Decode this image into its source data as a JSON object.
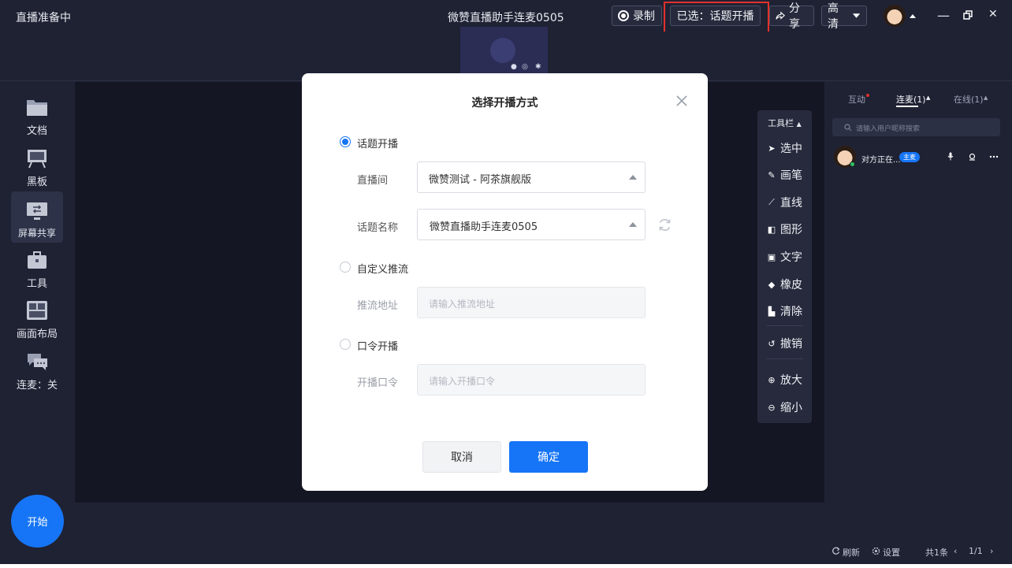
{
  "titlebar": {
    "status": "直播准备中",
    "title": "微赞直播助手连麦0505",
    "record_label": "录制",
    "selected_label": "已选：话题开播",
    "share_label": "分享",
    "quality_label": "高清",
    "minimize_glyph": "—",
    "close_glyph": "✕"
  },
  "sidebar": {
    "items": [
      {
        "label": "文档"
      },
      {
        "label": "黑板"
      },
      {
        "label": "屏幕共享"
      },
      {
        "label": "工具"
      },
      {
        "label": "画面布局"
      },
      {
        "label": "连麦：关"
      }
    ],
    "start_label": "开始"
  },
  "toolbar": {
    "header": "工具栏",
    "tools": [
      {
        "label": "选中",
        "icon": "cursor-icon"
      },
      {
        "label": "画笔",
        "icon": "pen-icon"
      },
      {
        "label": "直线",
        "icon": "line-icon"
      },
      {
        "label": "图形",
        "icon": "shape-icon"
      },
      {
        "label": "文字",
        "icon": "text-icon"
      },
      {
        "label": "橡皮",
        "icon": "eraser-icon"
      },
      {
        "label": "清除",
        "icon": "clear-icon"
      },
      {
        "label": "撤销",
        "icon": "undo-icon"
      },
      {
        "label": "放大",
        "icon": "zoom-in-icon"
      },
      {
        "label": "缩小",
        "icon": "zoom-out-icon"
      }
    ]
  },
  "right_panel": {
    "tabs": [
      {
        "label": "互动"
      },
      {
        "label": "连麦(1)"
      },
      {
        "label": "在线(1)"
      }
    ],
    "search_placeholder": "请输入用户昵称搜索",
    "user": {
      "name": "对方正在...",
      "badge": "主麦"
    },
    "refresh_label": "刷新",
    "settings_label": "设置",
    "total_label": "共1条",
    "page_label": "1/1"
  },
  "modal": {
    "title": "选择开播方式",
    "option_topic": "话题开播",
    "room_label": "直播间",
    "room_value": "微赞测试 - 阿茶旗舰版",
    "topic_label": "话题名称",
    "topic_value": "微赞直播助手连麦0505",
    "option_custom": "自定义推流",
    "push_label": "推流地址",
    "push_placeholder": "请输入推流地址",
    "option_password": "口令开播",
    "password_label": "开播口令",
    "password_placeholder": "请输入开播口令",
    "cancel_label": "取消",
    "confirm_label": "确定"
  },
  "colors": {
    "accent": "#1675f6",
    "annotation_red": "#e5312b",
    "app_bg": "#1f2233"
  }
}
